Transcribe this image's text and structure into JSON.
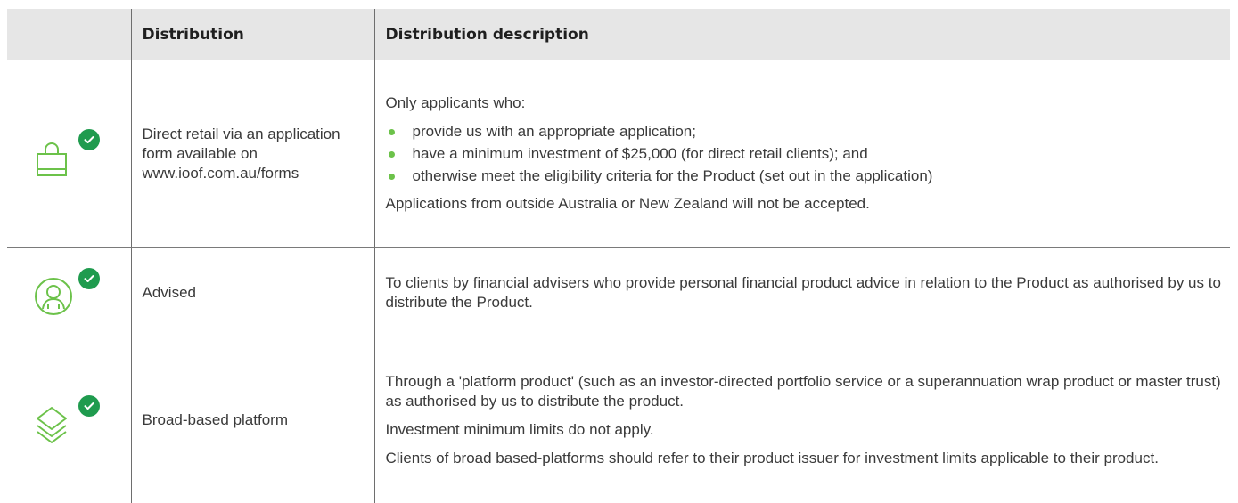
{
  "header": {
    "col_icon": "",
    "col_distribution": "Distribution",
    "col_description": "Distribution description"
  },
  "colors": {
    "icon_green": "#6cc24a",
    "check_green": "#1f9b4e",
    "header_bg": "#e6e6e6"
  },
  "rows": [
    {
      "icon": "shopping-bag-icon",
      "badge_icon": "check-circle-icon",
      "distribution": "Direct retail via an application form available on www.ioof.com.au/forms",
      "intro": "Only applicants who:",
      "bullets": [
        "provide us with an appropriate application;",
        "have a minimum investment of $25,000 (for direct retail clients); and",
        "otherwise meet the eligibility criteria for the Product (set out in the application)"
      ],
      "note": "Applications from outside Australia or New Zealand will not be accepted."
    },
    {
      "icon": "user-circle-icon",
      "badge_icon": "check-circle-icon",
      "distribution": "Advised",
      "description": "To clients by financial advisers who provide personal financial product advice in relation to the Product as authorised by us to distribute the Product."
    },
    {
      "icon": "layers-icon",
      "badge_icon": "check-circle-icon",
      "distribution": "Broad-based platform",
      "paragraphs": [
        "Through a 'platform product' (such as an investor-directed portfolio service or a superannuation wrap product or master trust) as authorised by us to distribute the product.",
        "Investment minimum limits do not apply.",
        "Clients of broad based-platforms should refer to their product issuer for investment limits applicable to their product."
      ]
    }
  ]
}
